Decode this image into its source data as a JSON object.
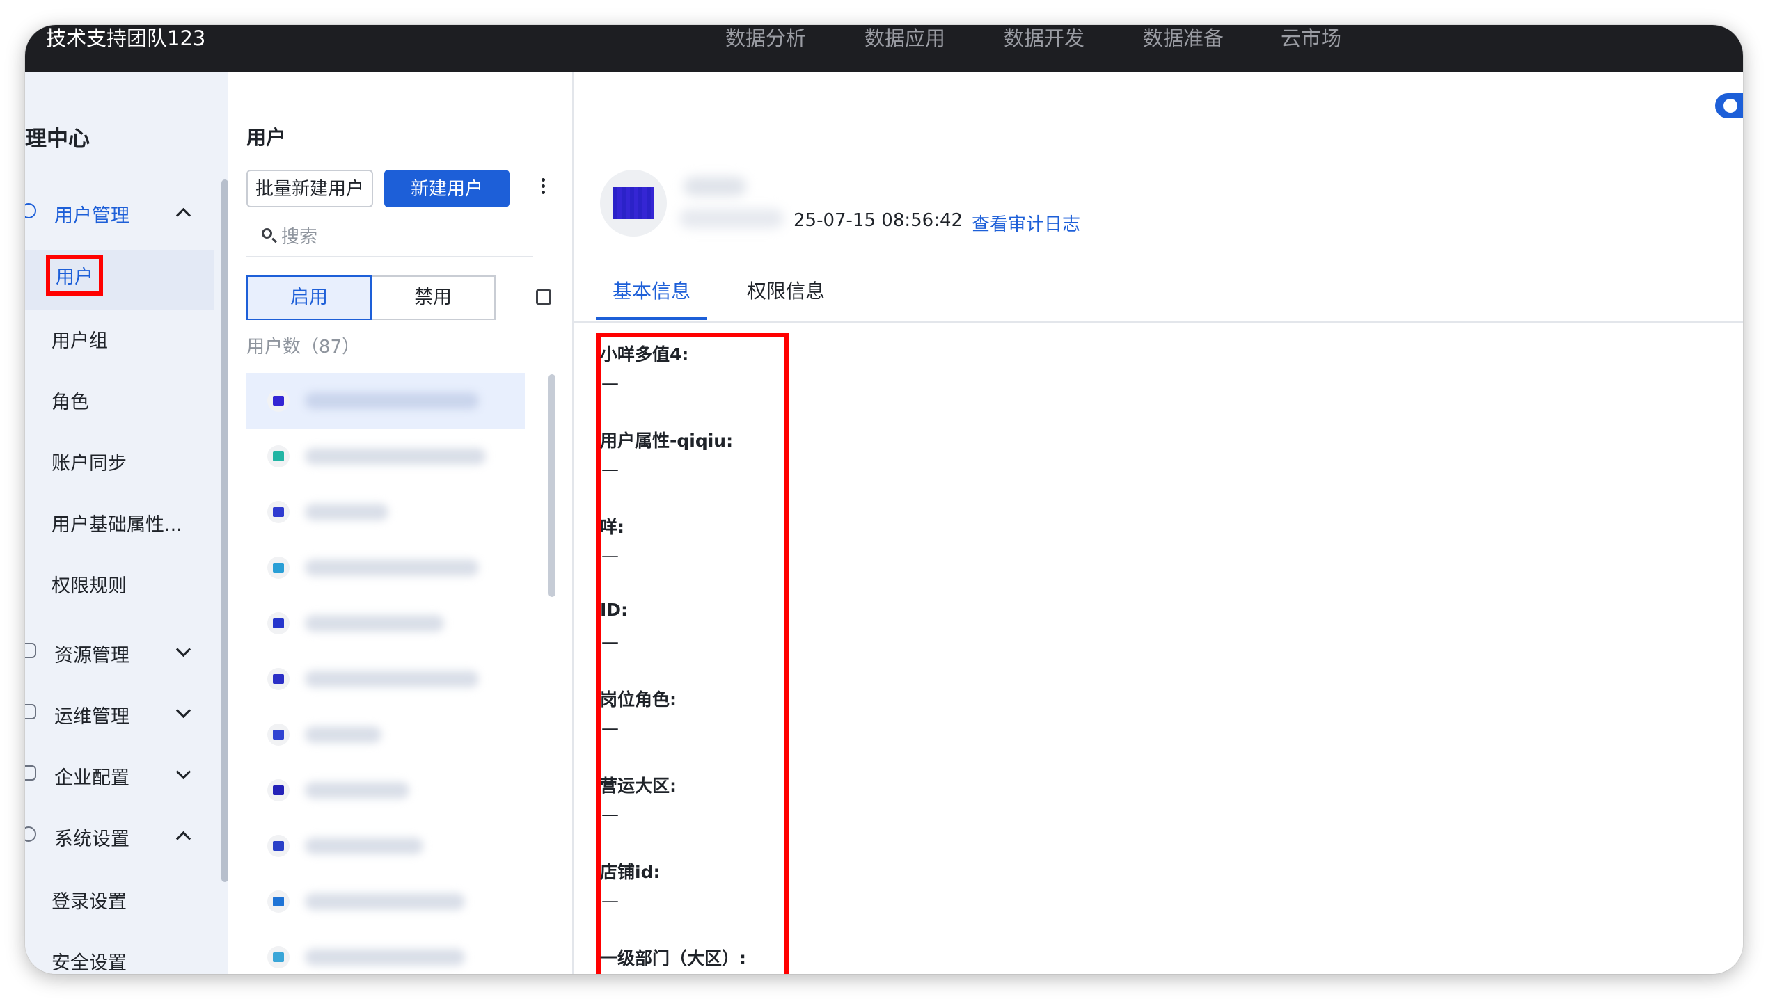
{
  "topbar": {
    "org_name": "技术支持团队123",
    "nav": [
      "数据分析",
      "数据应用",
      "数据开发",
      "数据准备",
      "云市场"
    ]
  },
  "sidebar": {
    "title": "理中心",
    "groups": [
      {
        "label": "用户管理",
        "icon": "user-circle-icon",
        "expanded": true
      },
      {
        "label": "资源管理",
        "icon": "nodes-icon",
        "expanded": false
      },
      {
        "label": "运维管理",
        "icon": "monitor-icon",
        "expanded": false
      },
      {
        "label": "企业配置",
        "icon": "building-icon",
        "expanded": false
      },
      {
        "label": "系统设置",
        "icon": "gear-icon",
        "expanded": true
      }
    ],
    "user_mgmt_items": [
      "用户",
      "用户组",
      "角色",
      "账户同步",
      "用户基础属性...",
      "权限规则"
    ],
    "system_items": [
      "登录设置",
      "安全设置"
    ]
  },
  "user_list": {
    "title": "用户",
    "batch_create_label": "批量新建用户",
    "create_label": "新建用户",
    "search_placeholder": "搜索",
    "segment_enabled": "启用",
    "segment_disabled": "禁用",
    "count_label": "用户数（87）"
  },
  "detail": {
    "last_login_time": "25-07-15 08:56:42",
    "audit_link": "查看审计日志",
    "tabs": [
      "基本信息",
      "权限信息"
    ],
    "fields": [
      {
        "label": "小咩多值4:",
        "value": "—"
      },
      {
        "label": "用户属性-qiqiu:",
        "value": "—"
      },
      {
        "label": "咩:",
        "value": "—"
      },
      {
        "label": "ID:",
        "value": "—"
      },
      {
        "label": "岗位角色:",
        "value": "—"
      },
      {
        "label": "营运大区:",
        "value": "—"
      },
      {
        "label": "店铺id:",
        "value": "—"
      },
      {
        "label": "一级部门（大区）:",
        "value": "—"
      }
    ]
  },
  "colors": {
    "accent": "#1d5fd8",
    "topbar": "#1d1e22",
    "sidebar_bg": "#eef2f9",
    "highlight_box": "#ff0000"
  }
}
